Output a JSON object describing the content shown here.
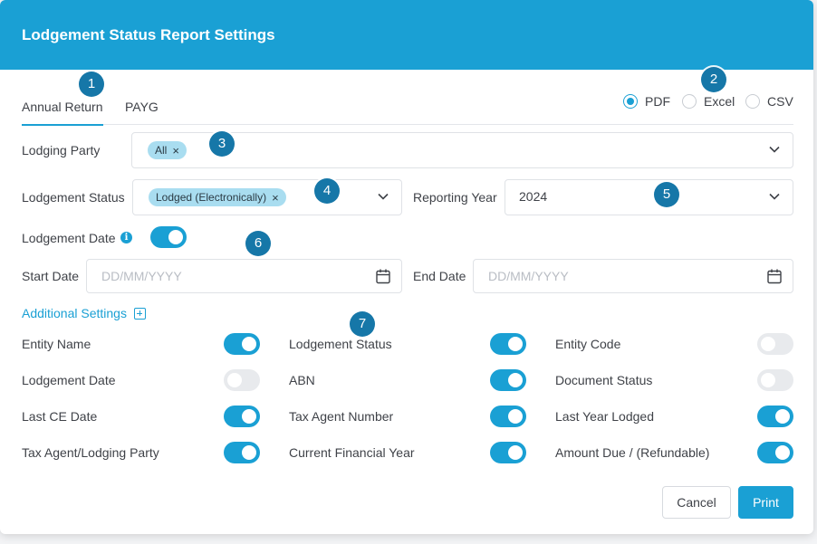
{
  "title": "Lodgement Status Report Settings",
  "tabs": [
    {
      "label": "Annual Return",
      "active": true
    },
    {
      "label": "PAYG",
      "active": false
    }
  ],
  "format": {
    "options": [
      "PDF",
      "Excel",
      "CSV"
    ],
    "selected": "PDF"
  },
  "lodging_party": {
    "label": "Lodging Party",
    "chips": [
      "All"
    ]
  },
  "lodgement_status": {
    "label": "Lodgement Status",
    "chips": [
      "Lodged (Electronically)"
    ]
  },
  "reporting_year": {
    "label": "Reporting Year",
    "value": "2024"
  },
  "lodgement_date": {
    "label": "Lodgement Date",
    "enabled": true
  },
  "start_date": {
    "label": "Start Date",
    "placeholder": "DD/MM/YYYY"
  },
  "end_date": {
    "label": "End Date",
    "placeholder": "DD/MM/YYYY"
  },
  "additional_settings": {
    "label": "Additional Settings",
    "columns": [
      [
        {
          "label": "Entity Name",
          "on": true
        },
        {
          "label": "Lodgement Date",
          "on": false
        },
        {
          "label": "Last CE Date",
          "on": true
        },
        {
          "label": "Tax Agent/Lodging Party",
          "on": true
        }
      ],
      [
        {
          "label": "Lodgement Status",
          "on": true
        },
        {
          "label": "ABN",
          "on": true
        },
        {
          "label": "Tax Agent Number",
          "on": true
        },
        {
          "label": "Current Financial Year",
          "on": true
        }
      ],
      [
        {
          "label": "Entity Code",
          "on": false
        },
        {
          "label": "Document Status",
          "on": false
        },
        {
          "label": "Last Year Lodged",
          "on": true
        },
        {
          "label": "Amount Due / (Refundable)",
          "on": true
        }
      ]
    ]
  },
  "buttons": {
    "cancel": "Cancel",
    "print": "Print"
  },
  "markers": [
    "1",
    "2",
    "3",
    "4",
    "5",
    "6",
    "7"
  ],
  "colors": {
    "accent": "#1aa0d4",
    "marker": "#1677a8",
    "chip": "#a9ddf0"
  }
}
